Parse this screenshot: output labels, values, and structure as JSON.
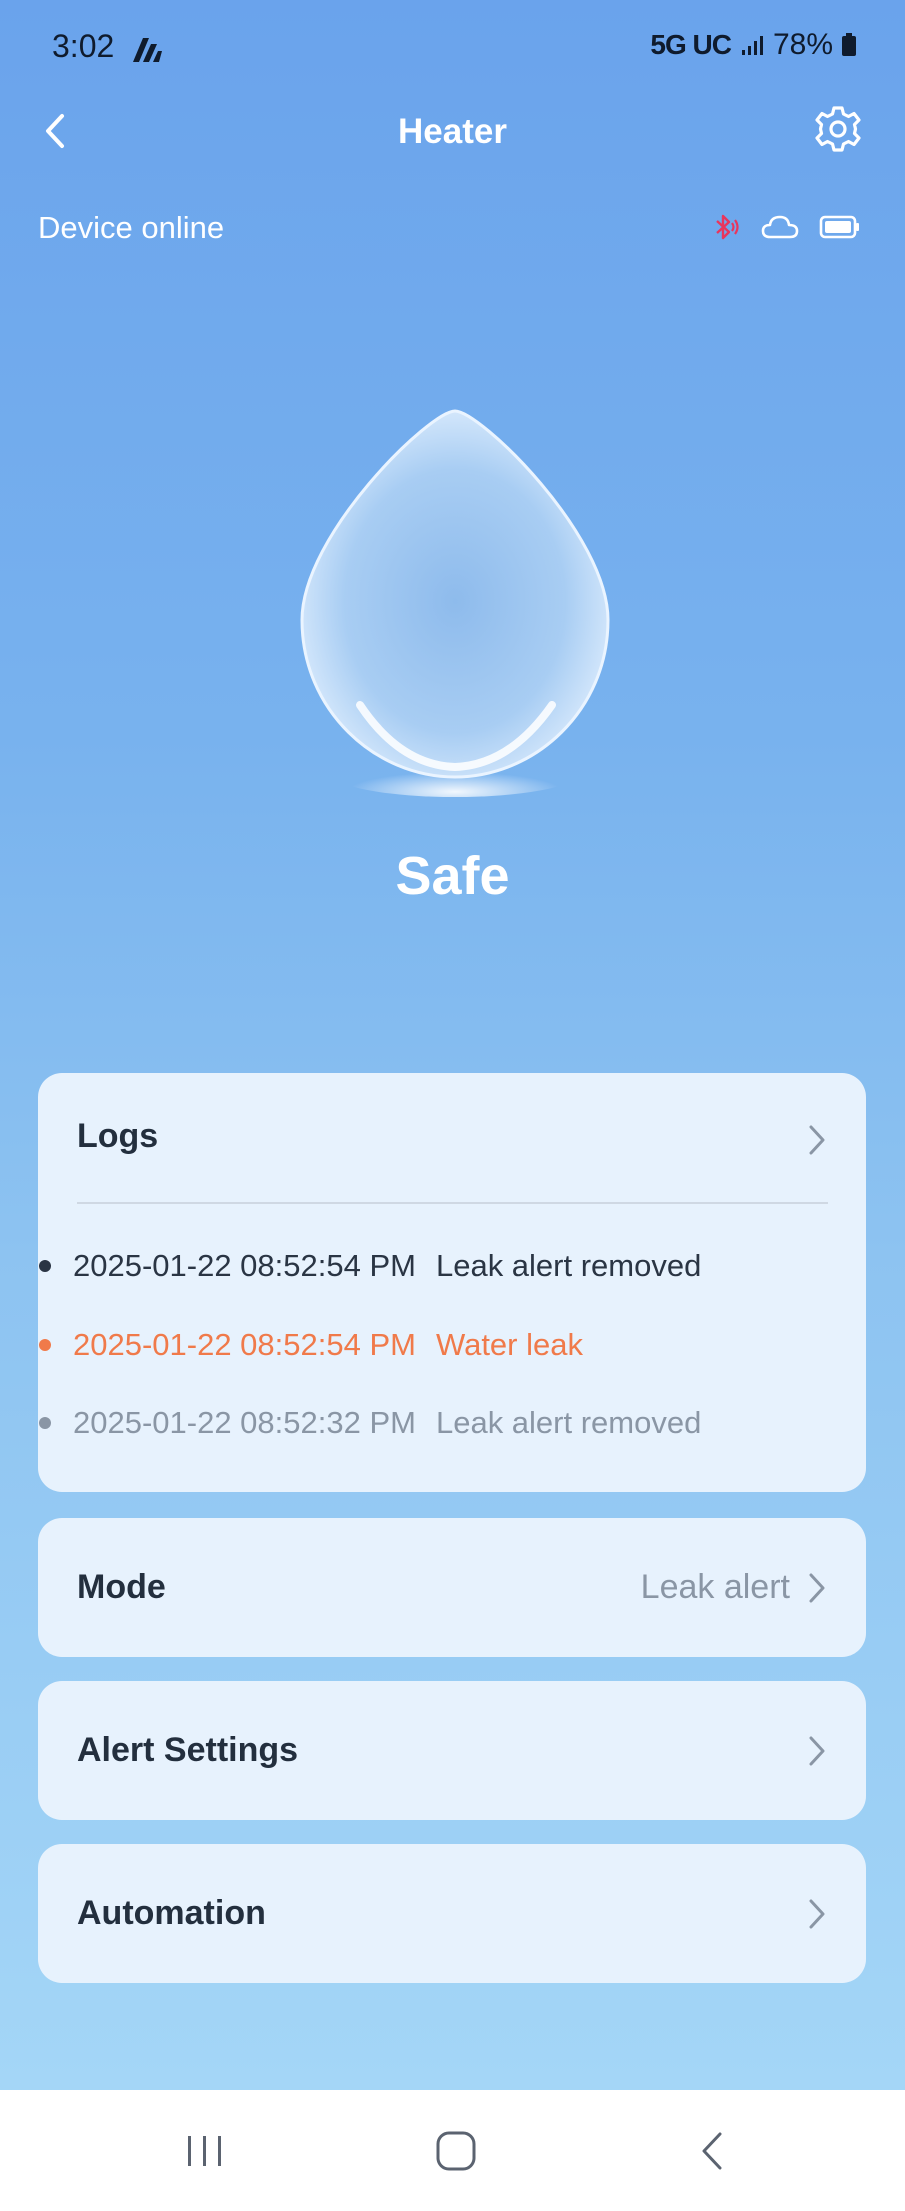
{
  "status": {
    "time": "3:02",
    "network": "5G UC",
    "battery": "78%"
  },
  "header": {
    "title": "Heater"
  },
  "device": {
    "status_text": "Device online"
  },
  "state": {
    "label": "Safe"
  },
  "logs": {
    "title": "Logs",
    "entries": [
      {
        "time": "2025-01-22 08:52:54 PM",
        "message": "Leak alert removed"
      },
      {
        "time": "2025-01-22 08:52:54 PM",
        "message": "Water leak"
      },
      {
        "time": "2025-01-22 08:52:32 PM",
        "message": "Leak alert removed"
      }
    ]
  },
  "mode": {
    "label": "Mode",
    "value": "Leak alert"
  },
  "alert_settings": {
    "label": "Alert Settings"
  },
  "automation": {
    "label": "Automation"
  },
  "colors": {
    "accent_alert": "#f07a4a",
    "bluetooth": "#e8365d",
    "background_top": "#6aa3ec"
  }
}
